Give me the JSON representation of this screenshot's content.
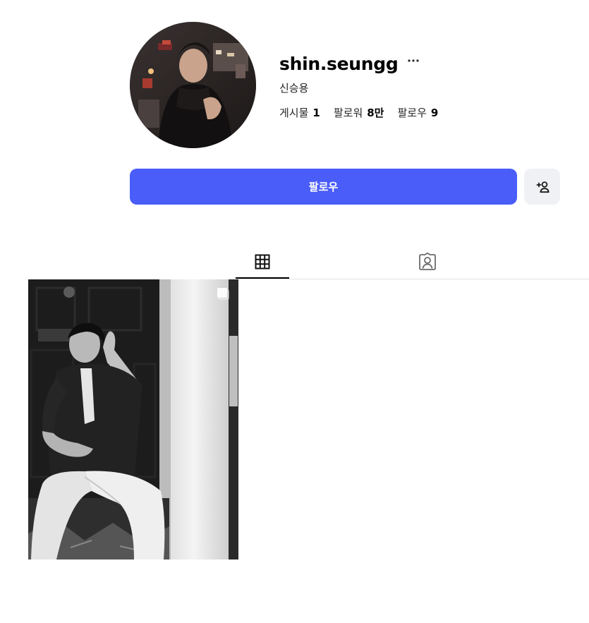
{
  "profile": {
    "username": "shin.seungg",
    "full_name": "신승용",
    "more_label": "···"
  },
  "stats": {
    "posts_label": "게시물",
    "posts_count": "1",
    "followers_label": "팔로워",
    "followers_count": "8만",
    "following_label": "팔로우",
    "following_count": "9"
  },
  "actions": {
    "follow_label": "팔로우",
    "add_friend_icon": "person-add-icon"
  },
  "tabs": [
    {
      "name": "posts",
      "icon": "grid-icon",
      "active": true
    },
    {
      "name": "tagged",
      "icon": "tagged-person-icon",
      "active": false
    }
  ],
  "posts": [
    {
      "type": "photo",
      "multi": true,
      "badge_icon": "multi-photo-icon"
    }
  ],
  "colors": {
    "accent": "#4a5df9",
    "secondary_button": "#eff1f4",
    "divider": "#e4e4e4"
  }
}
